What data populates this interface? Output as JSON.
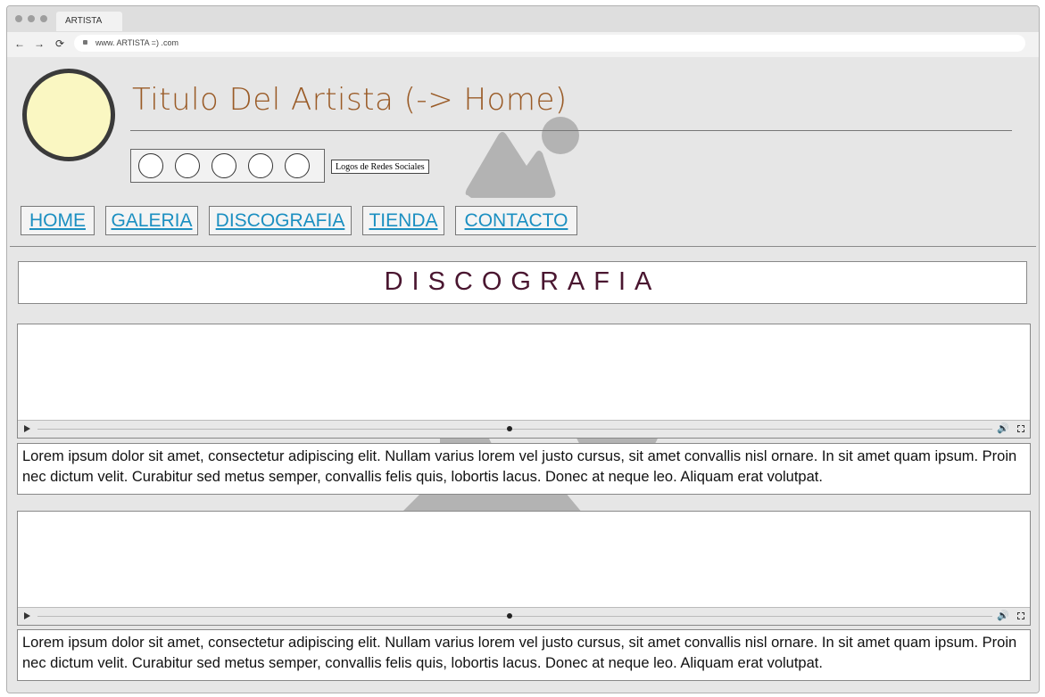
{
  "browser": {
    "tab_title": "ARTISTA",
    "url": "www. ARTISTA =) .com",
    "back_icon": "←",
    "forward_icon": "→",
    "reload_icon": "⟳"
  },
  "header": {
    "site_title": "Titulo Del Artista (-> Home)",
    "social_label": "Logos de Redes Sociales"
  },
  "menu": {
    "items": [
      {
        "label": "HOME"
      },
      {
        "label": "GALERIA"
      },
      {
        "label": "DISCOGRAFIA"
      },
      {
        "label": "TIENDA"
      },
      {
        "label": "CONTACTO"
      }
    ]
  },
  "section": {
    "title": "DISCOGRAFIA"
  },
  "entries": [
    {
      "description": "Lorem ipsum dolor sit amet, consectetur adipiscing elit. Nullam varius lorem vel justo cursus, sit amet convallis nisl ornare. In sit amet quam ipsum. Proin nec dictum velit. Curabitur sed metus semper, convallis felis quis, lobortis lacus. Donec at neque leo. Aliquam erat volutpat."
    },
    {
      "description": "Lorem ipsum dolor sit amet, consectetur adipiscing elit. Nullam varius lorem vel justo cursus, sit amet convallis nisl ornare. In sit amet quam ipsum. Proin nec dictum velit. Curabitur sed metus semper, convallis felis quis, lobortis lacus. Donec at neque leo. Aliquam erat volutpat."
    }
  ],
  "colors": {
    "title": "#9a5b27",
    "link": "#1b8fc1",
    "section_title": "#4a1630",
    "avatar_fill": "#faf7c2"
  }
}
